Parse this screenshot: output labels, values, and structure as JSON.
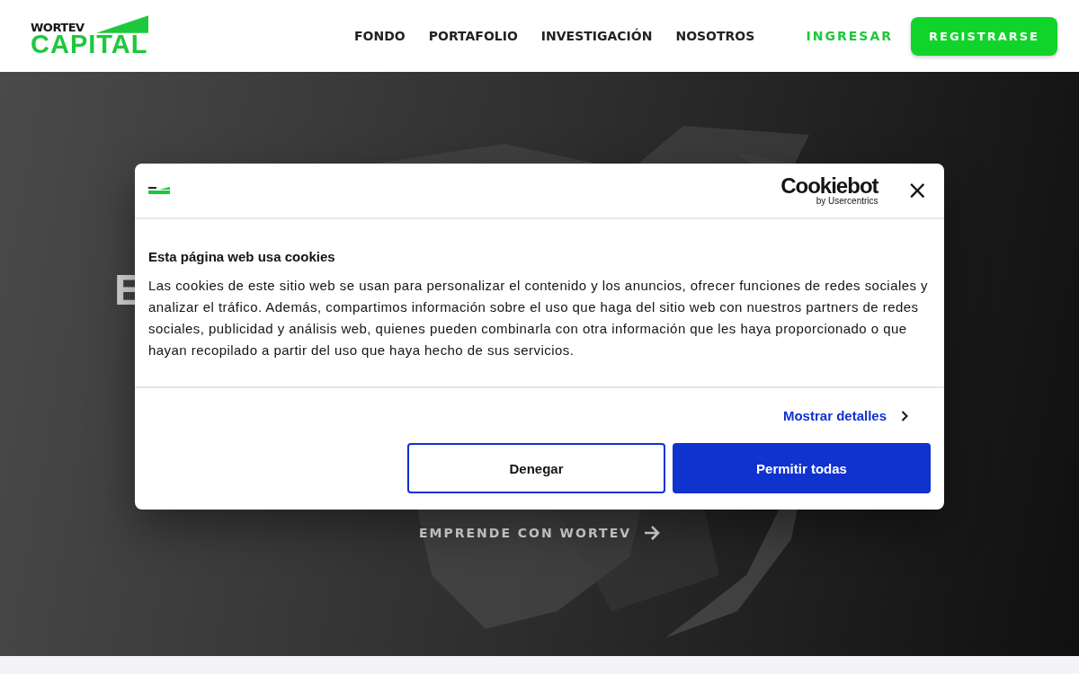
{
  "header": {
    "logo": {
      "top": "WORTEV",
      "bottom": "CAPITAL"
    },
    "nav": [
      {
        "label": "FONDO"
      },
      {
        "label": "PORTAFOLIO"
      },
      {
        "label": "INVESTIGACIÓN"
      },
      {
        "label": "NOSOTROS"
      }
    ],
    "login": "INGRESAR",
    "signup": "REGISTRARSE"
  },
  "hero": {
    "headline_start": "E",
    "cta": "EMPRENDE CON WORTEV"
  },
  "cookie_dialog": {
    "brand": "Cookiebot",
    "brand_sub": "by Usercentrics",
    "close": "×",
    "title": "Esta página web usa cookies",
    "text": "Las cookies de este sitio web se usan para personalizar el contenido y los anuncios, ofrecer funciones de redes sociales y analizar el tráfico. Además, compartimos información sobre el uso que haga del sitio web con nuestros partners de redes sociales, publicidad y análisis web, quienes pueden combinarla con otra información que les haya proporcionado o que hayan recopilado a partir del uso que haya hecho de sus servicios.",
    "details_link": "Mostrar detalles",
    "buttons": [
      {
        "label": "Denegar",
        "kind": "outline"
      },
      {
        "label": "Permitir todas",
        "kind": "primary"
      }
    ]
  }
}
